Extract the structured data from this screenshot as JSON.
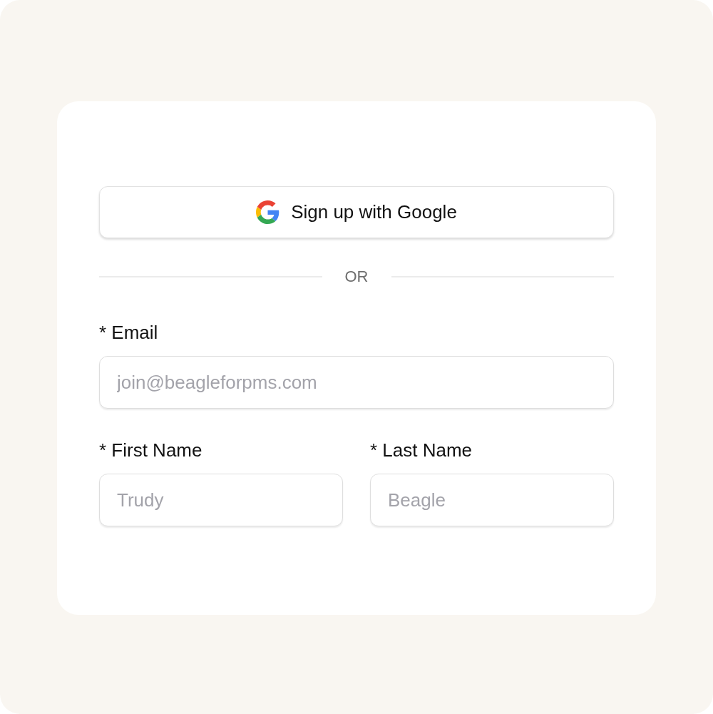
{
  "google_button": {
    "label": "Sign up with Google"
  },
  "divider": {
    "label": "OR"
  },
  "fields": [
    {
      "label": "* Email",
      "placeholder": "join@beagleforpms.com",
      "kind": "full"
    },
    {
      "label": "* First Name",
      "placeholder": "Trudy",
      "kind": "half"
    },
    {
      "label": "* Last Name",
      "placeholder": "Beagle",
      "kind": "half"
    }
  ]
}
